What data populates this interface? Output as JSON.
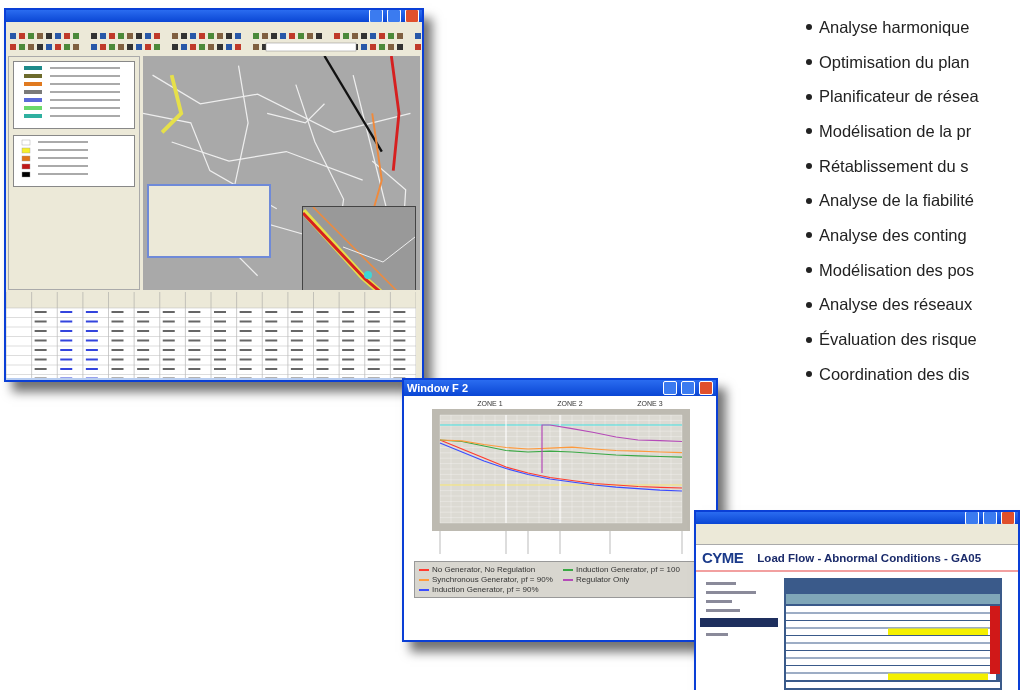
{
  "features": [
    {
      "label": "Analyse harmonique"
    },
    {
      "label": "Optimisation du plan"
    },
    {
      "label": "Planificateur de résea"
    },
    {
      "label": "Modélisation de la pr"
    },
    {
      "label": "Rétablissement du s"
    },
    {
      "label": "Analyse de la fiabilité"
    },
    {
      "label": "Analyse des conting"
    },
    {
      "label": "Modélisation des pos"
    },
    {
      "label": "Analyse des réseaux"
    },
    {
      "label": "Évaluation des risque"
    },
    {
      "label": "Coordination des dis"
    }
  ],
  "chart_window": {
    "title": "Window F 2",
    "zones": [
      "ZONE 1",
      "ZONE 2",
      "ZONE 3"
    ],
    "legend": [
      {
        "label": "No Generator, No Regulation",
        "color": "#ff3b2f"
      },
      {
        "label": "Induction Generator, pf = 100",
        "color": "#3aa845"
      },
      {
        "label": "Synchronous Generator, pf = 90%",
        "color": "#ff9a3c"
      },
      {
        "label": "Regulator Only",
        "color": "#b54ab8"
      },
      {
        "label": "Induction Generator, pf = 90%",
        "color": "#3b4cff"
      }
    ]
  },
  "report_window": {
    "logo": "CYME",
    "heading": "Load Flow - Abnormal Conditions - GA05"
  }
}
